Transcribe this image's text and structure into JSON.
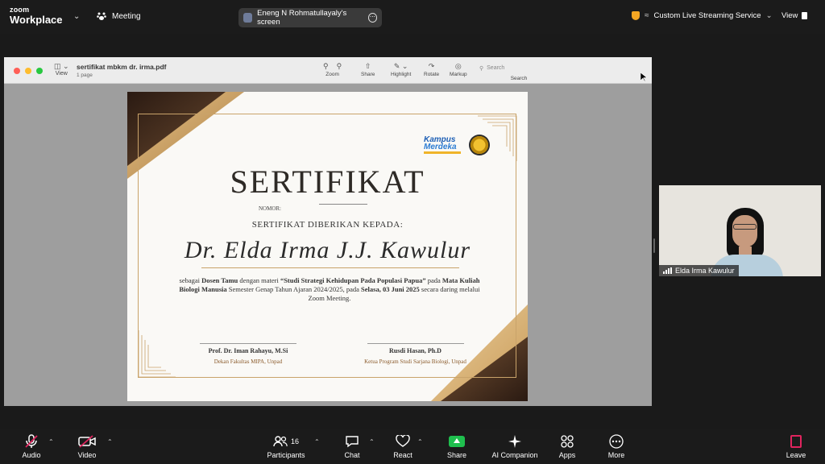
{
  "topbar": {
    "logo_line1": "zoom",
    "logo_line2": "Workplace",
    "meeting_label": "Meeting",
    "share_title": "Eneng N Rohmatullayaly's screen",
    "stream_label": "Custom Live Streaming Service",
    "view_label": "View"
  },
  "preview": {
    "view_label": "View",
    "file_name": "sertifikat mbkm dr. irma.pdf",
    "page_count": "1 page",
    "tools": {
      "zoom": "Zoom",
      "share": "Share",
      "highlight": "Highlight",
      "rotate": "Rotate",
      "markup": "Markup"
    },
    "search_placeholder": "Search",
    "search_label": "Search"
  },
  "certificate": {
    "logo_kampus": "Kampus",
    "logo_merdeka": "Merdeka",
    "title": "SERTIFIKAT",
    "nomor": "NOMOR:",
    "diberikan": "SERTIFIKAT DIBERIKAN KEPADA:",
    "recipient": "Dr. Elda Irma J.J. Kawulur",
    "body": {
      "p1": "sebagai ",
      "role": "Dosen Tamu",
      "p2": " dengan materi ",
      "topic": "“Studi Strategi Kehidupan Pada Populasi Papua”",
      "p3": " pada ",
      "course": "Mata Kuliah Biologi Manusia",
      "p4": " Semester Genap Tahun Ajaran 2024/2025, pada ",
      "date": "Selasa, 03 Juni 2025",
      "p5": " secara daring melalui Zoom Meeting."
    },
    "sig_left_name": "Prof. Dr. Iman Rahayu, M.Si",
    "sig_left_position": "Dekan Fakultas MIPA, Unpad",
    "sig_right_name": "Rusdi Hasan, Ph.D",
    "sig_right_position": "Ketua Program Studi Sarjana Biologi, Unpad"
  },
  "participant": {
    "name": "Elda Irma Kawulur"
  },
  "toolbar": {
    "audio": "Audio",
    "video": "Video",
    "participants": "Participants",
    "participants_count": "16",
    "chat": "Chat",
    "react": "React",
    "share": "Share",
    "ai_companion": "AI Companion",
    "apps": "Apps",
    "more": "More",
    "leave": "Leave"
  },
  "colors": {
    "share_green": "#1fbf4e",
    "leave_red": "#e0245e",
    "gold": "#c9a36a",
    "mute_red": "#e0245e"
  }
}
